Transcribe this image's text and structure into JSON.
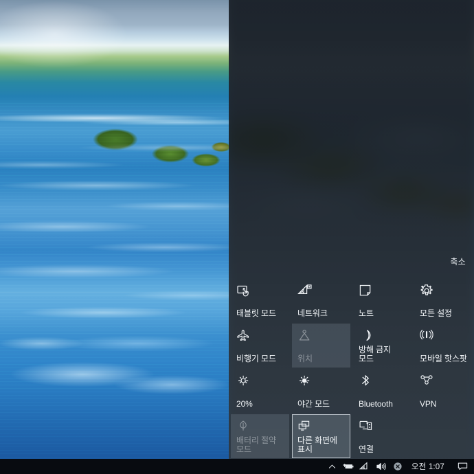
{
  "desktop": {
    "wallpaper_description": "ocean-waves-seascape",
    "accent_color": "#0078d7",
    "panel_bg_color": "#2b3640",
    "tile_bg_color": "#76868e",
    "taskbar_bg_color": "#080b10"
  },
  "action_center": {
    "collapse_label": "축소",
    "tiles": [
      {
        "label": "태블릿 모드",
        "icon": "tablet-mode-icon",
        "state": "on"
      },
      {
        "label": "네트워크",
        "icon": "network-wifi-icon",
        "state": "on"
      },
      {
        "label": "노트",
        "icon": "note-icon",
        "state": "on"
      },
      {
        "label": "모든 설정",
        "icon": "settings-gear-icon",
        "state": "on"
      },
      {
        "label": "비행기 모드",
        "icon": "airplane-icon",
        "state": "on"
      },
      {
        "label": "위치",
        "icon": "location-icon",
        "state": "disabled"
      },
      {
        "label": "방해 금지 모드",
        "icon": "moon-icon",
        "state": "on"
      },
      {
        "label": "모바일 핫스팟",
        "icon": "hotspot-icon",
        "state": "on"
      },
      {
        "label": "20%",
        "icon": "brightness-icon",
        "state": "on"
      },
      {
        "label": "야간 모드",
        "icon": "night-light-icon",
        "state": "on"
      },
      {
        "label": "Bluetooth",
        "icon": "bluetooth-icon",
        "state": "on"
      },
      {
        "label": "VPN",
        "icon": "vpn-icon",
        "state": "on"
      },
      {
        "label": "배터리 절약 모드",
        "icon": "battery-saver-icon",
        "state": "disabled"
      },
      {
        "label": "다른 화면에 표시",
        "icon": "project-icon",
        "state": "focused"
      },
      {
        "label": "연결",
        "icon": "connect-icon",
        "state": "on"
      }
    ]
  },
  "taskbar": {
    "tray_icons": [
      {
        "name": "show-hidden-icons-chevron",
        "glyph": "chevron-up-icon"
      },
      {
        "name": "battery-charging-icon",
        "glyph": "battery-icon"
      },
      {
        "name": "network-wifi-icon",
        "glyph": "wifi-icon"
      },
      {
        "name": "volume-icon",
        "glyph": "speaker-icon"
      },
      {
        "name": "error-status-icon",
        "glyph": "x-circle-icon"
      }
    ],
    "clock": "오전 1:07",
    "action_center_button": "action-center-icon"
  }
}
